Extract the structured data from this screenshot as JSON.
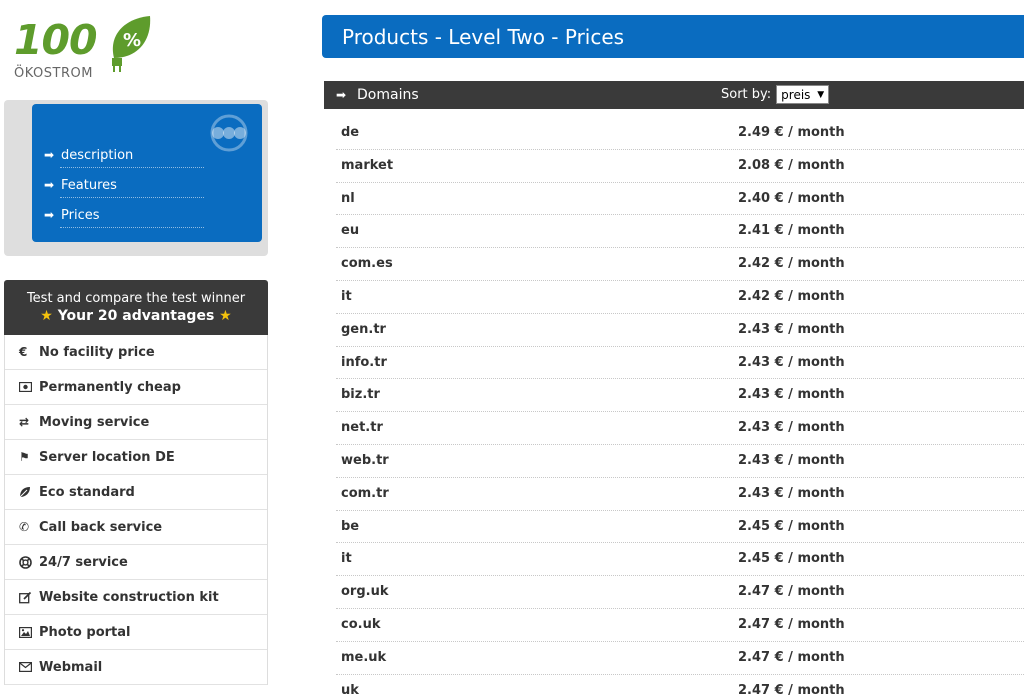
{
  "logo": {
    "number": "100",
    "word": "ÖKOSTROM",
    "leaf_symbol": "%"
  },
  "nav": {
    "items": [
      {
        "label": "description"
      },
      {
        "label": "Features"
      },
      {
        "label": "Prices"
      }
    ]
  },
  "advantages": {
    "title_line1": "Test and compare the test winner",
    "title_line2": "Your 20 advantages",
    "items": [
      {
        "label": "No facility price",
        "icon": "euro-icon"
      },
      {
        "label": "Permanently cheap",
        "icon": "money-icon"
      },
      {
        "label": "Moving service",
        "icon": "exchange-icon"
      },
      {
        "label": "Server location DE",
        "icon": "flag-icon"
      },
      {
        "label": "Eco standard",
        "icon": "leaf-icon"
      },
      {
        "label": "Call back service",
        "icon": "phone-icon"
      },
      {
        "label": "24/7 service",
        "icon": "lifebuoy-icon"
      },
      {
        "label": "Website construction kit",
        "icon": "edit-icon"
      },
      {
        "label": "Photo portal",
        "icon": "photo-icon"
      },
      {
        "label": "Webmail",
        "icon": "envelope-icon"
      }
    ]
  },
  "main": {
    "title": "Products - Level Two - Prices",
    "table": {
      "title": "Domains",
      "sort_label": "Sort by:",
      "sort_value": "preis",
      "rows": [
        {
          "domain": "de",
          "price": "2.49 € / month"
        },
        {
          "domain": "market",
          "price": "2.08 € / month"
        },
        {
          "domain": "nl",
          "price": "2.40 € / month"
        },
        {
          "domain": "eu",
          "price": "2.41 € / month"
        },
        {
          "domain": "com.es",
          "price": "2.42 € / month"
        },
        {
          "domain": "it",
          "price": "2.42 € / month"
        },
        {
          "domain": "gen.tr",
          "price": "2.43 € / month"
        },
        {
          "domain": "info.tr",
          "price": "2.43 € / month"
        },
        {
          "domain": "biz.tr",
          "price": "2.43 € / month"
        },
        {
          "domain": "net.tr",
          "price": "2.43 € / month"
        },
        {
          "domain": "web.tr",
          "price": "2.43 € / month"
        },
        {
          "domain": "com.tr",
          "price": "2.43 € / month"
        },
        {
          "domain": "be",
          "price": "2.45 € / month"
        },
        {
          "domain": "it",
          "price": "2.45 € / month"
        },
        {
          "domain": "org.uk",
          "price": "2.47 € / month"
        },
        {
          "domain": "co.uk",
          "price": "2.47 € / month"
        },
        {
          "domain": "me.uk",
          "price": "2.47 € / month"
        },
        {
          "domain": "uk",
          "price": "2.47 € / month"
        }
      ]
    }
  },
  "colors": {
    "brand_blue": "#0a6cc0",
    "dark_header": "#3a3a3a",
    "logo_green": "#5e9c2c",
    "star": "#f4c20d"
  }
}
